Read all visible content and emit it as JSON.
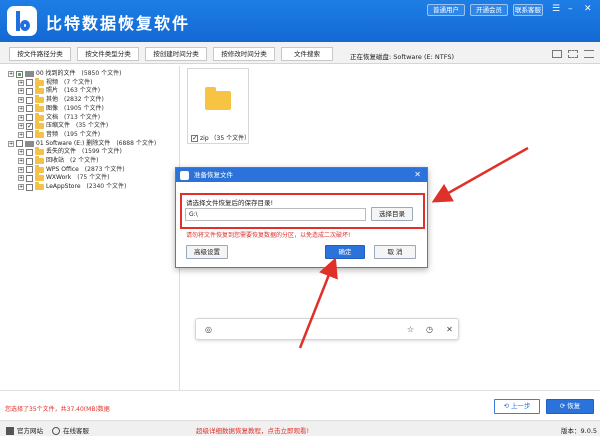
{
  "app": {
    "title": "比特数据恢复软件"
  },
  "header": {
    "buttons": [
      "普通用户",
      "开通会员",
      "联系客服"
    ],
    "window_controls": [
      "☰",
      "–",
      "✕"
    ]
  },
  "tabs": [
    "按文件路径分类",
    "按文件类型分类",
    "按创建时间分类",
    "按修改时间分类",
    "文件搜索"
  ],
  "disk_info": "正在恢复磁盘: Software (E: NTFS)",
  "tree": [
    {
      "name": "00 找到的文件",
      "count": "(5850 个文件)",
      "level": 0,
      "check": "partial",
      "icon": "drive"
    },
    {
      "name": "视频",
      "count": "(7 个文件)",
      "level": 1,
      "check": "none",
      "icon": "folder"
    },
    {
      "name": "照片",
      "count": "(163 个文件)",
      "level": 1,
      "check": "none",
      "icon": "folder"
    },
    {
      "name": "其他",
      "count": "(2832 个文件)",
      "level": 1,
      "check": "none",
      "icon": "folder"
    },
    {
      "name": "图像",
      "count": "(1905 个文件)",
      "level": 1,
      "check": "none",
      "icon": "folder"
    },
    {
      "name": "文档",
      "count": "(713 个文件)",
      "level": 1,
      "check": "none",
      "icon": "folder"
    },
    {
      "name": "压缩文件",
      "count": "(35 个文件)",
      "level": 1,
      "check": "checked",
      "icon": "folder"
    },
    {
      "name": "音频",
      "count": "(195 个文件)",
      "level": 1,
      "check": "none",
      "icon": "folder"
    },
    {
      "name": "01 Software (E:) 删除文件",
      "count": "(6888 个文件)",
      "level": 0,
      "check": "none",
      "icon": "drive"
    },
    {
      "name": "丢失的文件",
      "count": "(1599 个文件)",
      "level": 1,
      "check": "none",
      "icon": "folder"
    },
    {
      "name": "回收站",
      "count": "(2 个文件)",
      "level": 1,
      "check": "none",
      "icon": "folder"
    },
    {
      "name": "WPS Office",
      "count": "(2873 个文件)",
      "level": 1,
      "check": "none",
      "icon": "folder"
    },
    {
      "name": "WXWork",
      "count": "(75 个文件)",
      "level": 1,
      "check": "none",
      "icon": "folder"
    },
    {
      "name": "LeAppStore",
      "count": "(2340 个文件)",
      "level": 1,
      "check": "none",
      "icon": "folder"
    }
  ],
  "tile": {
    "label": "zip （35 个文件）",
    "checked": true
  },
  "dialog": {
    "title": "准备恢复文件",
    "close": "✕",
    "prompt": "请选择文件恢复后的保存目录!",
    "path_value": "G:\\",
    "browse_label": "选择目录",
    "warning": "请勿将文件恢复到您需要恢复数据的分区，以免造成二次破坏!",
    "advanced_label": "高级设置",
    "ok_label": "确定",
    "cancel_label": "取 消"
  },
  "searchbar": {
    "icons": [
      "scan-icon",
      "star-icon",
      "clock-icon",
      "tools-icon"
    ]
  },
  "status": {
    "selected_info": "您选择了35个文件，共37.40(MB)数据",
    "back_label": "上一步",
    "recover_label": "恢复"
  },
  "footer": {
    "website": "官方网站",
    "support": "在线客服",
    "tutorial": "超级详细数据恢复教程，点击立即观看!",
    "version": "版本：9.0.5"
  },
  "colors": {
    "brand": "#1e7ee6",
    "warning": "#e0302a",
    "highlight_box": "#e0302a"
  }
}
